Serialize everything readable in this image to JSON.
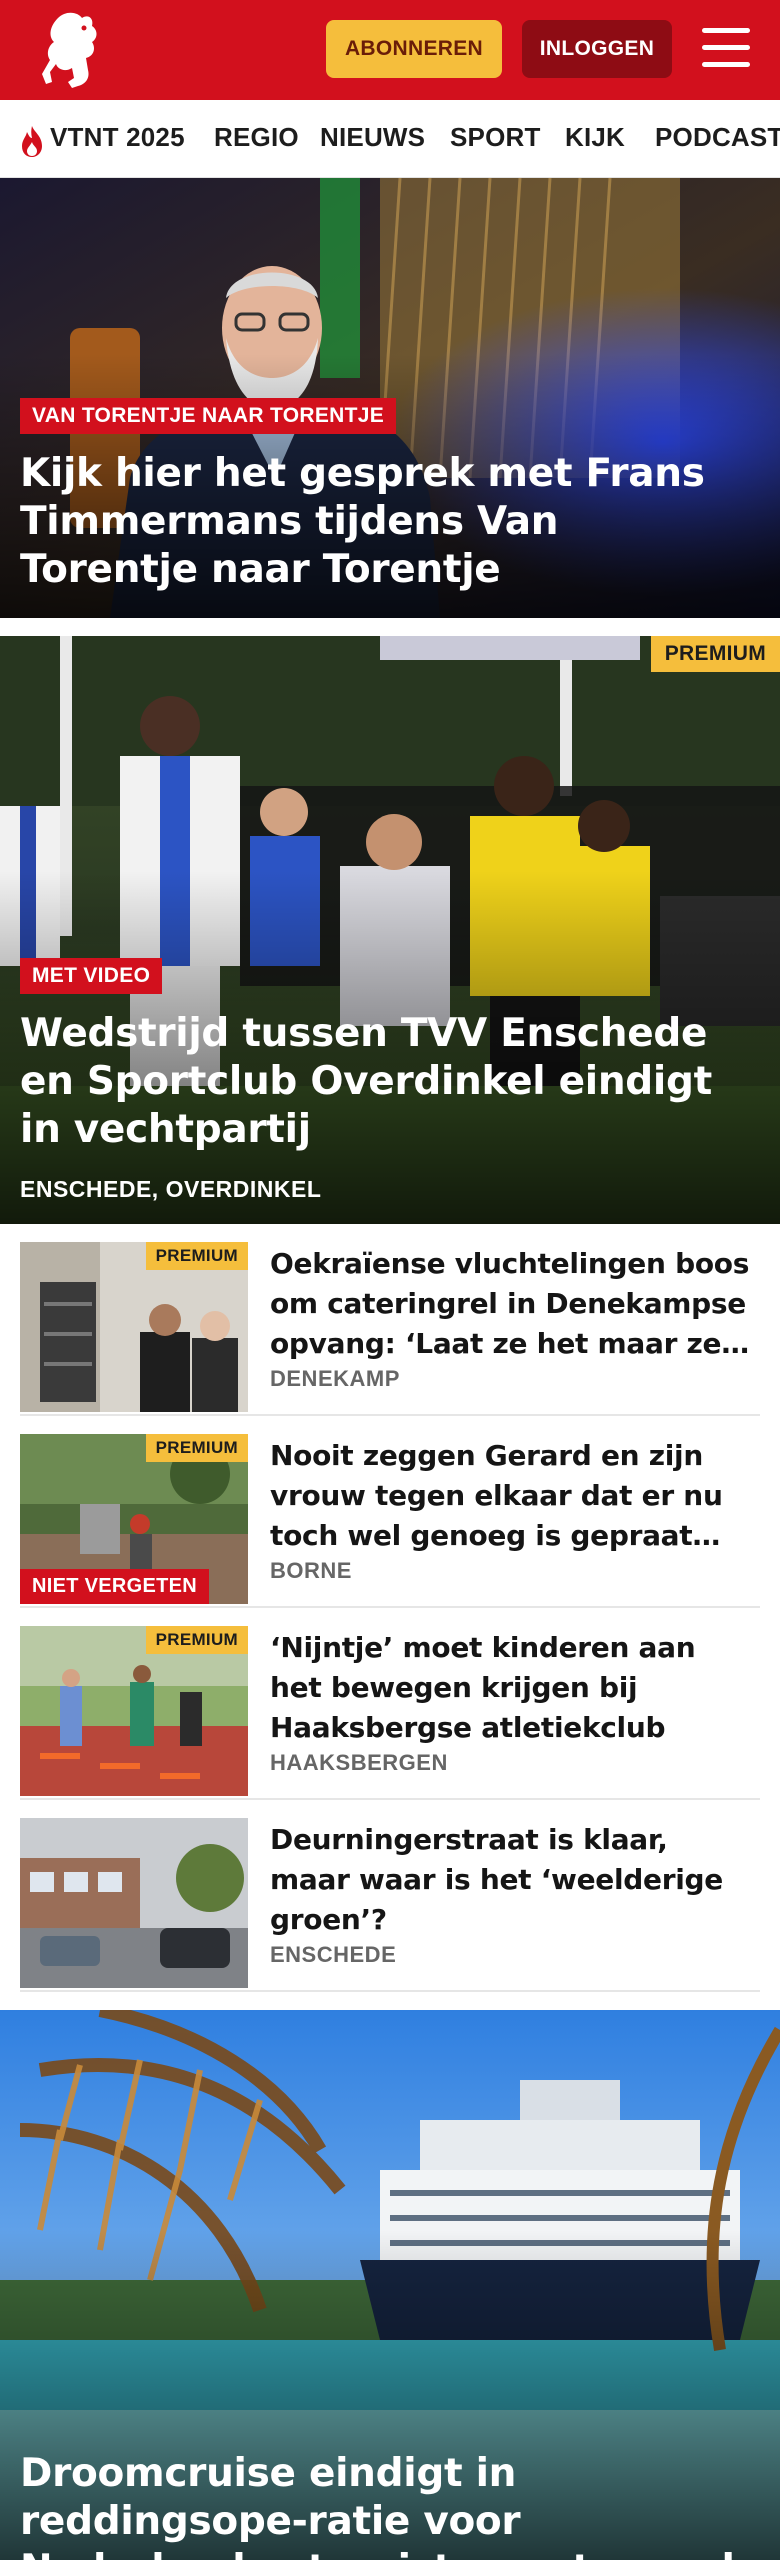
{
  "header": {
    "subscribe_label": "ABONNEREN",
    "login_label": "INLOGGEN",
    "brand_color": "#d2101d",
    "subscribe_color": "#f5be3c",
    "login_color": "#8e0c14"
  },
  "nav": {
    "items": [
      {
        "label": "VTNT 2025",
        "icon": "flame-icon"
      },
      {
        "label": "REGIO"
      },
      {
        "label": "NIEUWS"
      },
      {
        "label": "SPORT"
      },
      {
        "label": "KIJK"
      },
      {
        "label": "PODCAST"
      }
    ]
  },
  "hero1": {
    "tag": "VAN TORENTJE NAAR TORENTJE",
    "title": "Kijk hier het gesprek met Frans Timmermans tijdens Van Torentje naar Torentje"
  },
  "hero2": {
    "premium": "PREMIUM",
    "tag": "MET VIDEO",
    "title": "Wedstrijd tussen TVV Enschede en Sportclub Overdinkel eindigt in vechtpartij",
    "place": "ENSCHEDE, OVERDINKEL"
  },
  "articles": [
    {
      "premium": "PREMIUM",
      "title": "Oekraïense vluchtelingen boos om cateringrel in Denekampse opvang: ‘Laat ze het maar zelf regelen’",
      "place": "DENEKAMP"
    },
    {
      "premium": "PREMIUM",
      "tag": "NIET VERGETEN",
      "title": "Nooit zeggen Gerard en zijn vrouw tegen elkaar dat er nu toch wel genoeg is gepraat over hun zoon",
      "place": "BORNE"
    },
    {
      "premium": "PREMIUM",
      "title": "‘Nijntje’ moet kinderen aan het bewegen krijgen bij Haaksbergse atletiekclub",
      "place": "HAAKSBERGEN"
    },
    {
      "title": "Deurningerstraat is klaar, maar waar is het ‘weelderige groen’?",
      "place": "ENSCHEDE"
    }
  ],
  "hero3": {
    "title": "Droomcruise eindigt in reddingsope-ratie voor Nederlandse toeriste, met snoed van schip gehaald"
  }
}
